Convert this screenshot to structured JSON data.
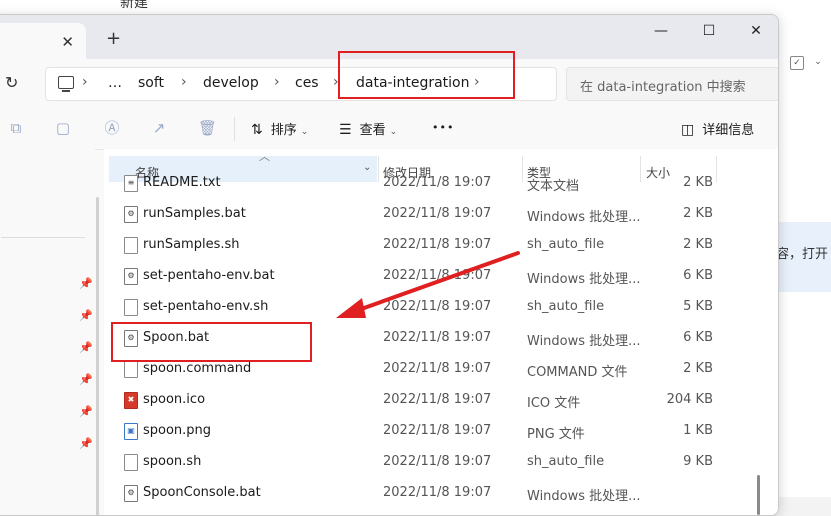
{
  "background": {
    "top_text": "新建",
    "right_text": "容，打开"
  },
  "tab": {
    "close_label": "✕",
    "new_tab_label": "+"
  },
  "window_controls": {
    "minimize": "—",
    "maximize": "☐",
    "close": "✕"
  },
  "address": {
    "refresh_icon": "↻",
    "crumbs": [
      "…",
      "soft",
      "develop",
      "ces",
      "data-integration"
    ],
    "separator": "›"
  },
  "search": {
    "placeholder": "在 data-integration 中搜索"
  },
  "toolbar": {
    "sort_label": "排序",
    "view_label": "查看",
    "more_label": "•••",
    "details_label": "详细信息"
  },
  "columns": {
    "name": "名称",
    "date": "修改日期",
    "type": "类型",
    "size": "大小"
  },
  "files": [
    {
      "name": "README.txt",
      "date": "2022/11/8 19:07",
      "type": "文本文档",
      "size": "2 KB",
      "icon": "txt-icon"
    },
    {
      "name": "runSamples.bat",
      "date": "2022/11/8 19:07",
      "type": "Windows 批处理...",
      "size": "2 KB",
      "icon": "bat-icon"
    },
    {
      "name": "runSamples.sh",
      "date": "2022/11/8 19:07",
      "type": "sh_auto_file",
      "size": "2 KB",
      "icon": "file-icon"
    },
    {
      "name": "set-pentaho-env.bat",
      "date": "2022/11/8 19:07",
      "type": "Windows 批处理...",
      "size": "6 KB",
      "icon": "bat-icon"
    },
    {
      "name": "set-pentaho-env.sh",
      "date": "2022/11/8 19:07",
      "type": "sh_auto_file",
      "size": "5 KB",
      "icon": "file-icon"
    },
    {
      "name": "Spoon.bat",
      "date": "2022/11/8 19:07",
      "type": "Windows 批处理...",
      "size": "6 KB",
      "icon": "bat-icon"
    },
    {
      "name": "spoon.command",
      "date": "2022/11/8 19:07",
      "type": "COMMAND 文件",
      "size": "2 KB",
      "icon": "file-icon"
    },
    {
      "name": "spoon.ico",
      "date": "2022/11/8 19:07",
      "type": "ICO 文件",
      "size": "204 KB",
      "icon": "ico-icon"
    },
    {
      "name": "spoon.png",
      "date": "2022/11/8 19:07",
      "type": "PNG 文件",
      "size": "1 KB",
      "icon": "png-icon"
    },
    {
      "name": "spoon.sh",
      "date": "2022/11/8 19:07",
      "type": "sh_auto_file",
      "size": "9 KB",
      "icon": "file-icon"
    },
    {
      "name": "SpoonConsole.bat",
      "date": "2022/11/8 19:07",
      "type": "Windows 批处理...",
      "size": "",
      "icon": "bat-icon"
    }
  ],
  "annotation_color": "#e02020"
}
